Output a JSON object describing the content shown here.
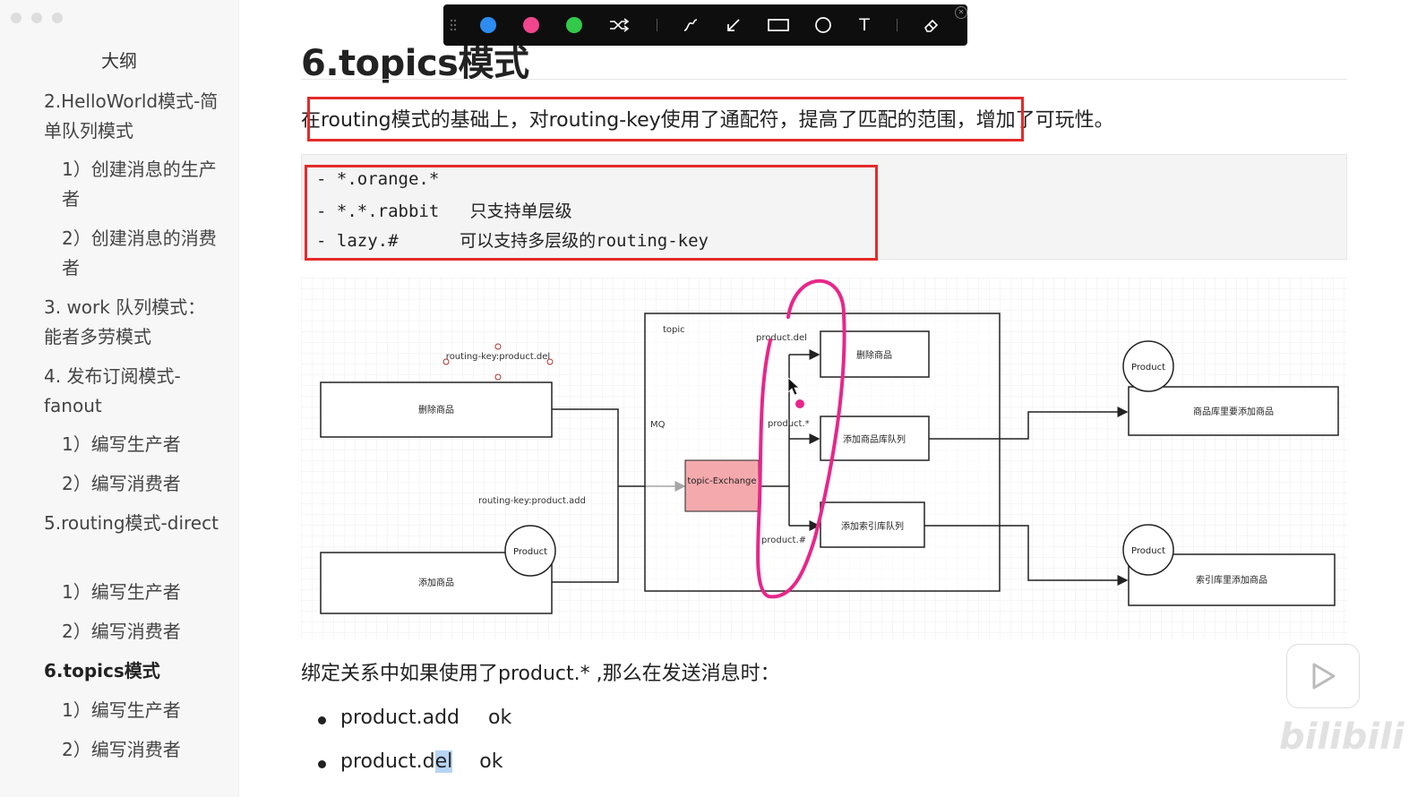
{
  "sidebar": {
    "title": "大纲",
    "items": [
      {
        "label": "2.HelloWorld模式-简单队列模式"
      },
      {
        "label": "1）创建消息的生产者"
      },
      {
        "label": "2）创建消息的消费者"
      },
      {
        "label": "3. work 队列模式：能者多劳模式"
      },
      {
        "label": "4. 发布订阅模式-fanout"
      },
      {
        "label": "1）编写生产者"
      },
      {
        "label": "2）编写消费者"
      },
      {
        "label": "5.routing模式-direct"
      },
      {
        "label": "1）编写生产者"
      },
      {
        "label": "2）编写消费者"
      },
      {
        "label": "6.topics模式"
      },
      {
        "label": "1）编写生产者"
      },
      {
        "label": "2）编写消费者"
      }
    ]
  },
  "main": {
    "heading": "6.topics模式",
    "intro": "在routing模式的基础上，对routing-key使用了通配符，提高了匹配的范围，增加了可玩性。",
    "code_lines": [
      "- *.orange.*",
      "- *.*.rabbit   只支持单层级",
      "- lazy.#      可以支持多层级的routing-key"
    ],
    "binding_text": "绑定关系中如果使用了product.* ,那么在发送消息时：",
    "list": [
      {
        "text": "product.add",
        "status": "ok"
      },
      {
        "pre": "product.d",
        "hl": "el",
        "status": "ok"
      }
    ]
  },
  "diagram": {
    "producer_del": "删除商品",
    "routing_key_del": "routing-key:product.del",
    "producer_add": "添加商品",
    "routing_key_add": "routing-key:product.add",
    "product_circle": "Product",
    "topic_label": "topic",
    "mq_label": "MQ",
    "exchange": "topic-Exchange",
    "bind_del": "product.del",
    "bind_star": "product.*",
    "bind_hash": "product.#",
    "q_del": "删除商品",
    "q_store": "添加商品库队列",
    "q_index": "添加索引库队列",
    "consumer_store": "商品库里要添加商品",
    "consumer_index": "索引库里添加商品",
    "exchange_color": "#f4a9ad",
    "annotation_color": "#e8268a"
  },
  "toolbar": {
    "colors": [
      "#2d8cf0",
      "#f0468e",
      "#33c94a"
    ],
    "tools": [
      "shuffle-icon",
      "pen-icon",
      "arrow-icon",
      "rectangle-icon",
      "circle-icon",
      "text-icon",
      "eraser-icon"
    ],
    "text_tool": "T"
  },
  "watermark": "bilibili"
}
